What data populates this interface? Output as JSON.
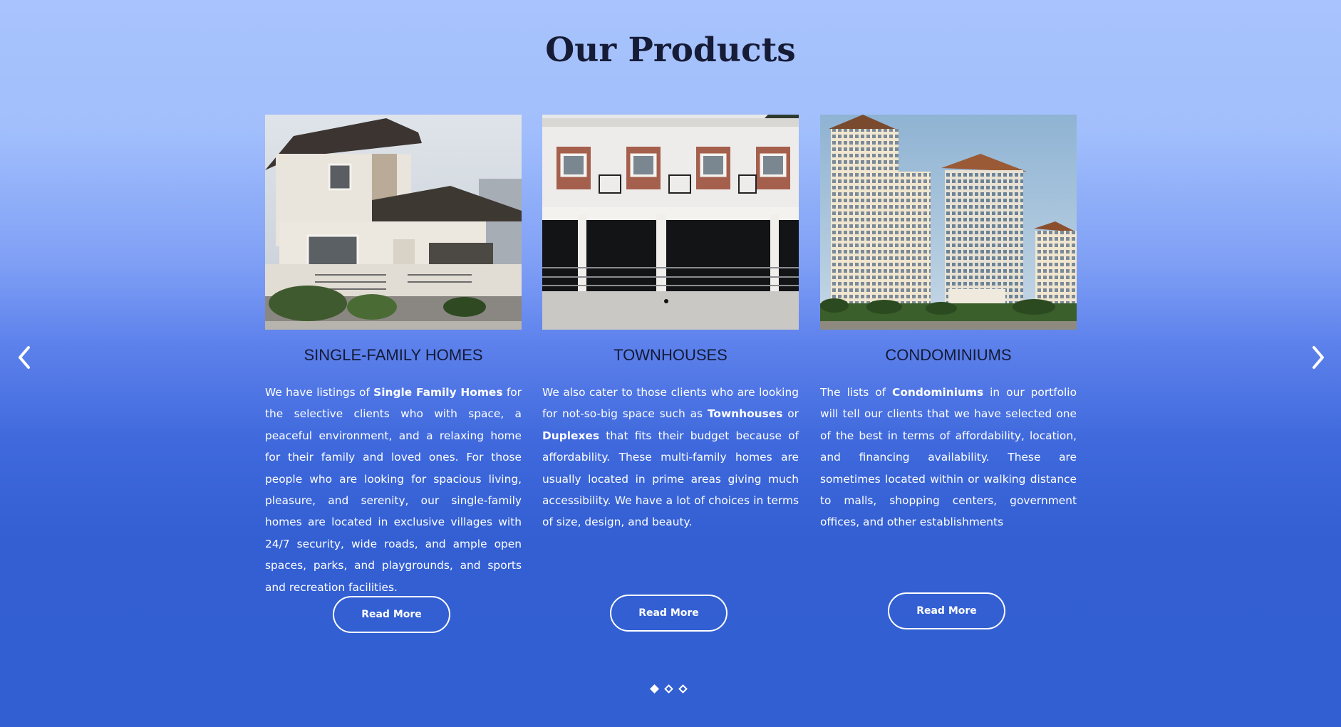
{
  "section": {
    "title": "Our Products"
  },
  "products": [
    {
      "title": "SINGLE-FAMILY HOMES",
      "desc": [
        {
          "t": "We have listings of "
        },
        {
          "t": "Single Family Homes",
          "b": true
        },
        {
          "t": " for the selective clients who with space, a peaceful environment, and a relaxing home for their family and loved ones. For those people who are looking for spacious living, pleasure, and serenity, our single-family homes are located in exclusive villages with 24/7 security, wide roads, and ample open spaces, parks, and playgrounds, and sports and recreation facilities."
        }
      ],
      "button": "Read More"
    },
    {
      "title": "TOWNHOUSES",
      "desc": [
        {
          "t": "We also cater to those clients who are looking for not-so-big space such as "
        },
        {
          "t": "Townhouses",
          "b": true
        },
        {
          "t": " or "
        },
        {
          "t": "Duplexes",
          "b": true
        },
        {
          "t": " that fits their budget because of affordability. These multi-family homes are usually located in prime areas giving much accessibility. We have a lot of choices in terms of size, design, and beauty."
        }
      ],
      "button": "Read More"
    },
    {
      "title": "CONDOMINIUMS",
      "desc": [
        {
          "t": "The lists of "
        },
        {
          "t": "Condominiums",
          "b": true
        },
        {
          "t": " in our portfolio will tell our clients that we have selected one of the best in terms of affordability, location, and financing availability. These are sometimes located within or walking distance to malls, shopping centers, government offices, and other establishments"
        }
      ],
      "button": "Read More"
    }
  ],
  "carousel": {
    "prev_icon": "chevron-left-icon",
    "next_icon": "chevron-right-icon",
    "dots": 3,
    "active_dot": 0
  },
  "colors": {
    "heading": "#161b36",
    "card_title": "#141a35",
    "text": "#ffffff",
    "bg_top": "#a8c3fd",
    "bg_bottom": "#325fd2"
  }
}
